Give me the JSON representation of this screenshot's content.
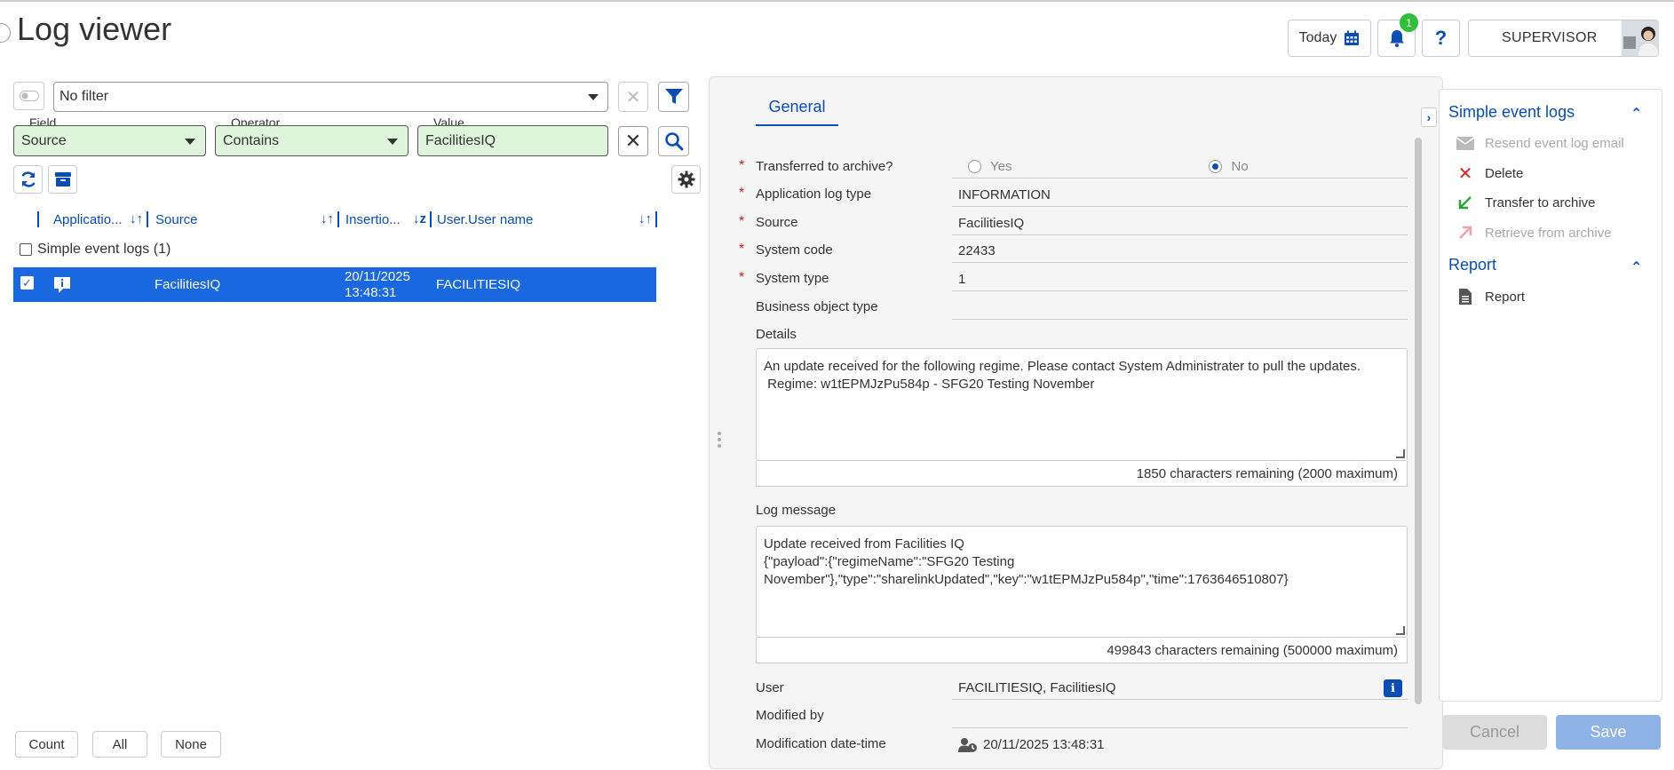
{
  "header": {
    "title": "Log viewer",
    "today_label": "Today",
    "notification_count": "1",
    "help_label": "?",
    "user_label": "SUPERVISOR"
  },
  "filter": {
    "selected": "No filter",
    "field_legend": "Field",
    "field_value": "Source",
    "operator_legend": "Operator",
    "operator_value": "Contains",
    "value_legend": "Value",
    "value_value": "FacilitiesIQ"
  },
  "table": {
    "columns": [
      "Applicatio...",
      "Source",
      "Insertio...",
      "User.User name"
    ],
    "group_label": "Simple event logs (1)",
    "rows": [
      {
        "source": "FacilitiesIQ",
        "insertion_date": "20/11/2025",
        "insertion_time": "13:48:31",
        "user": "FACILITIESIQ"
      }
    ]
  },
  "bottom_buttons": {
    "count": "Count",
    "all": "All",
    "none": "None"
  },
  "detail": {
    "tab": "General",
    "fields": {
      "transferred_label": "Transferred to archive?",
      "yes_label": "Yes",
      "no_label": "No",
      "app_log_type_label": "Application log type",
      "app_log_type_value": "INFORMATION",
      "source_label": "Source",
      "source_value": "FacilitiesIQ",
      "system_code_label": "System code",
      "system_code_value": "22433",
      "system_type_label": "System type",
      "system_type_value": "1",
      "business_object_type_label": "Business object type",
      "business_object_type_value": "",
      "details_label": "Details",
      "details_value": "An update received for the following regime. Please contact System Administrater to pull the updates.\n Regime: w1tEPMJzPu584p - SFG20 Testing November",
      "details_counter": "1850 characters remaining (2000 maximum)",
      "log_message_label": "Log message",
      "log_message_value": "Update received from Facilities IQ\n{\"payload\":{\"regimeName\":\"SFG20 Testing\nNovember\"},\"type\":\"sharelinkUpdated\",\"key\":\"w1tEPMJzPu584p\",\"time\":1763646510807}",
      "log_message_counter": "499843 characters remaining (500000 maximum)",
      "user_label": "User",
      "user_value": "FACILITIESIQ, FacilitiesIQ",
      "modified_by_label": "Modified by",
      "modified_by_value": "",
      "modification_label": "Modification date-time",
      "modification_value": "20/11/2025 13:48:31"
    }
  },
  "actions": {
    "group1_title": "Simple event logs",
    "items1": [
      {
        "label": "Resend event log email",
        "icon": "envelope-icon",
        "enabled": false
      },
      {
        "label": "Delete",
        "icon": "x-icon",
        "enabled": true
      },
      {
        "label": "Transfer to archive",
        "icon": "arrow-down-left-icon",
        "enabled": true
      },
      {
        "label": "Retrieve from archive",
        "icon": "arrow-up-right-icon",
        "enabled": false
      }
    ],
    "group2_title": "Report",
    "items2": [
      {
        "label": "Report",
        "icon": "document-icon",
        "enabled": true
      }
    ],
    "cancel_label": "Cancel",
    "save_label": "Save"
  },
  "colors": {
    "accent": "#0a4db3",
    "selected_row": "#1968e0",
    "filter_field_bg": "#dff5dc",
    "badge": "#2fbf3a",
    "required": "#c81e1e"
  }
}
